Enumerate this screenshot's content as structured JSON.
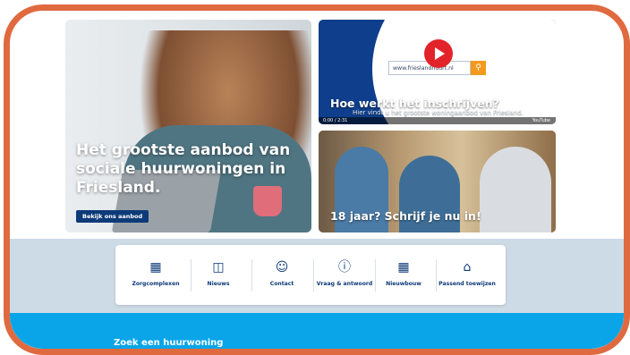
{
  "hero": {
    "title": "Het grootste aanbod van sociale huurwoningen in Friesland.",
    "button_label": "Bekijk ons aanbod"
  },
  "video": {
    "search_text": "www.frieslandhuurt.nl",
    "title": "Hoe werkt het inschrijven?",
    "subtitle": "Hier vindt u het grootste woningaanbod van Friesland.",
    "time": "0:00 / 2:31",
    "brand": "YouTube"
  },
  "promo": {
    "title": "18 jaar? Schrijf je nu in!"
  },
  "quicklinks": [
    {
      "label": "Zorgcomplexen",
      "icon": "building-icon"
    },
    {
      "label": "Nieuws",
      "icon": "newspaper-icon"
    },
    {
      "label": "Contact",
      "icon": "chat-icon"
    },
    {
      "label": "Vraag & antwoord",
      "icon": "question-icon"
    },
    {
      "label": "Nieuwbouw",
      "icon": "apartment-icon"
    },
    {
      "label": "Passend toewijzen",
      "icon": "house-icon"
    }
  ],
  "search_section": {
    "title": "Zoek een huurwoning"
  },
  "colors": {
    "frame": "#e06a3f",
    "navy": "#0d3a78",
    "band": "#cddbe6",
    "cyan": "#0aa5e8"
  }
}
